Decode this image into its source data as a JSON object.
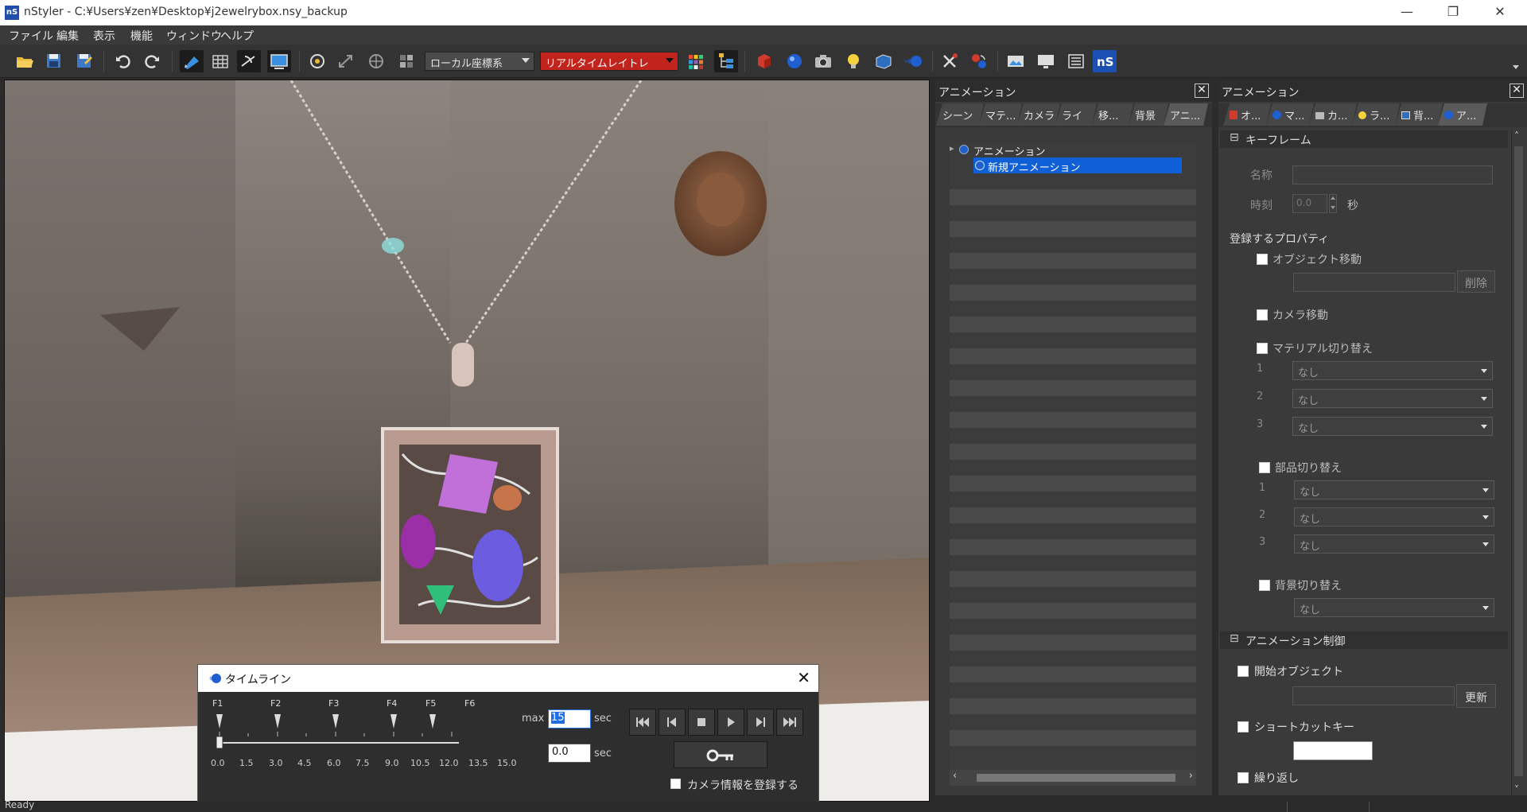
{
  "window": {
    "title": "nStyler - C:¥Users¥zen¥Desktop¥j2ewelrybox.nsy_backup",
    "app_icon": "nS",
    "minimize": "—",
    "restore": "❐",
    "close": "✕"
  },
  "menu": [
    "ファイル",
    "編集",
    "表示",
    "機能",
    "ウィンドウ",
    "ヘルプ"
  ],
  "toolbar": {
    "coord_system": "ローカル座標系",
    "render_mode": "リアルタイムレイトレ"
  },
  "timeline": {
    "title": "タイムライン",
    "frames": [
      "F1",
      "F2",
      "F3",
      "F4",
      "F5",
      "F6"
    ],
    "ticks": [
      "0.0",
      "1.5",
      "3.0",
      "4.5",
      "6.0",
      "7.5",
      "9.0",
      "10.5",
      "12.0",
      "13.5",
      "15.0"
    ],
    "max_label": "max",
    "max_value": "15",
    "unit": "sec",
    "current_value": "0.0",
    "camera_label": "カメラ情報を登録する"
  },
  "anim_panel": {
    "title": "アニメーション",
    "tabs": [
      "シーン",
      "マテ...",
      "カメラ",
      "ライト",
      "移...",
      "背景",
      "アニ..."
    ],
    "tree_root": "アニメーション",
    "tree_child": "新規アニメーション"
  },
  "prop_panel": {
    "title": "アニメーション",
    "tabs": [
      "オ...",
      "マ...",
      "カ...",
      "ラ...",
      "背...",
      "ア..."
    ],
    "keyframe_section": "キーフレーム",
    "name_label": "名称",
    "time_label": "時刻",
    "time_value": "0.0",
    "time_unit": "秒",
    "register_props": "登録するプロパティ",
    "object_move": "オブジェクト移動",
    "delete_btn": "削除",
    "camera_move": "カメラ移動",
    "material_switch": "マテリアル切り替え",
    "parts_switch": "部品切り替え",
    "bg_switch": "背景切り替え",
    "none": "なし",
    "idx1": "1",
    "idx2": "2",
    "idx3": "3",
    "control_section": "アニメーション制御",
    "start_object": "開始オブジェクト",
    "update_btn": "更新",
    "shortcut_key": "ショートカットキー",
    "repeat": "繰り返し"
  },
  "status": "Ready"
}
